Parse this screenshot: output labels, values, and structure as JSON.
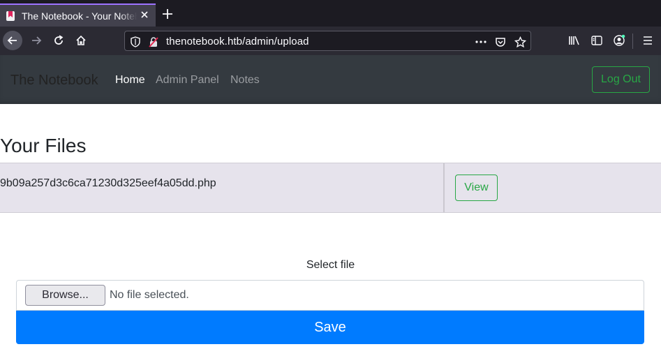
{
  "browser": {
    "tab_title": "The Notebook - Your Notebook",
    "url": "thenotebook.htb/admin/upload",
    "accent": "#9d73ff"
  },
  "icons": [
    "notebook-favicon",
    "close-icon",
    "plus-icon",
    "back-arrow-icon",
    "forward-arrow-icon",
    "reload-icon",
    "home-icon",
    "shield-icon",
    "insecure-lock-icon",
    "more-dots-icon",
    "pocket-icon",
    "star-icon",
    "library-icon",
    "sidebar-icon",
    "account-icon",
    "hamburger-menu-icon"
  ],
  "site": {
    "brand": "The Notebook",
    "nav": {
      "home": "Home",
      "admin": "Admin Panel",
      "notes": "Notes"
    },
    "logout": "Log Out"
  },
  "files": {
    "heading": "Your Files",
    "rows": [
      {
        "name": "9b09a257d3c6ca71230d325eef4a05dd.php",
        "action": "View"
      }
    ]
  },
  "upload": {
    "label": "Select file",
    "browse": "Browse...",
    "status": "No file selected.",
    "submit": "Save"
  },
  "colors": {
    "primary": "#007bff",
    "success": "#28a745",
    "navbar": "#343a40"
  }
}
